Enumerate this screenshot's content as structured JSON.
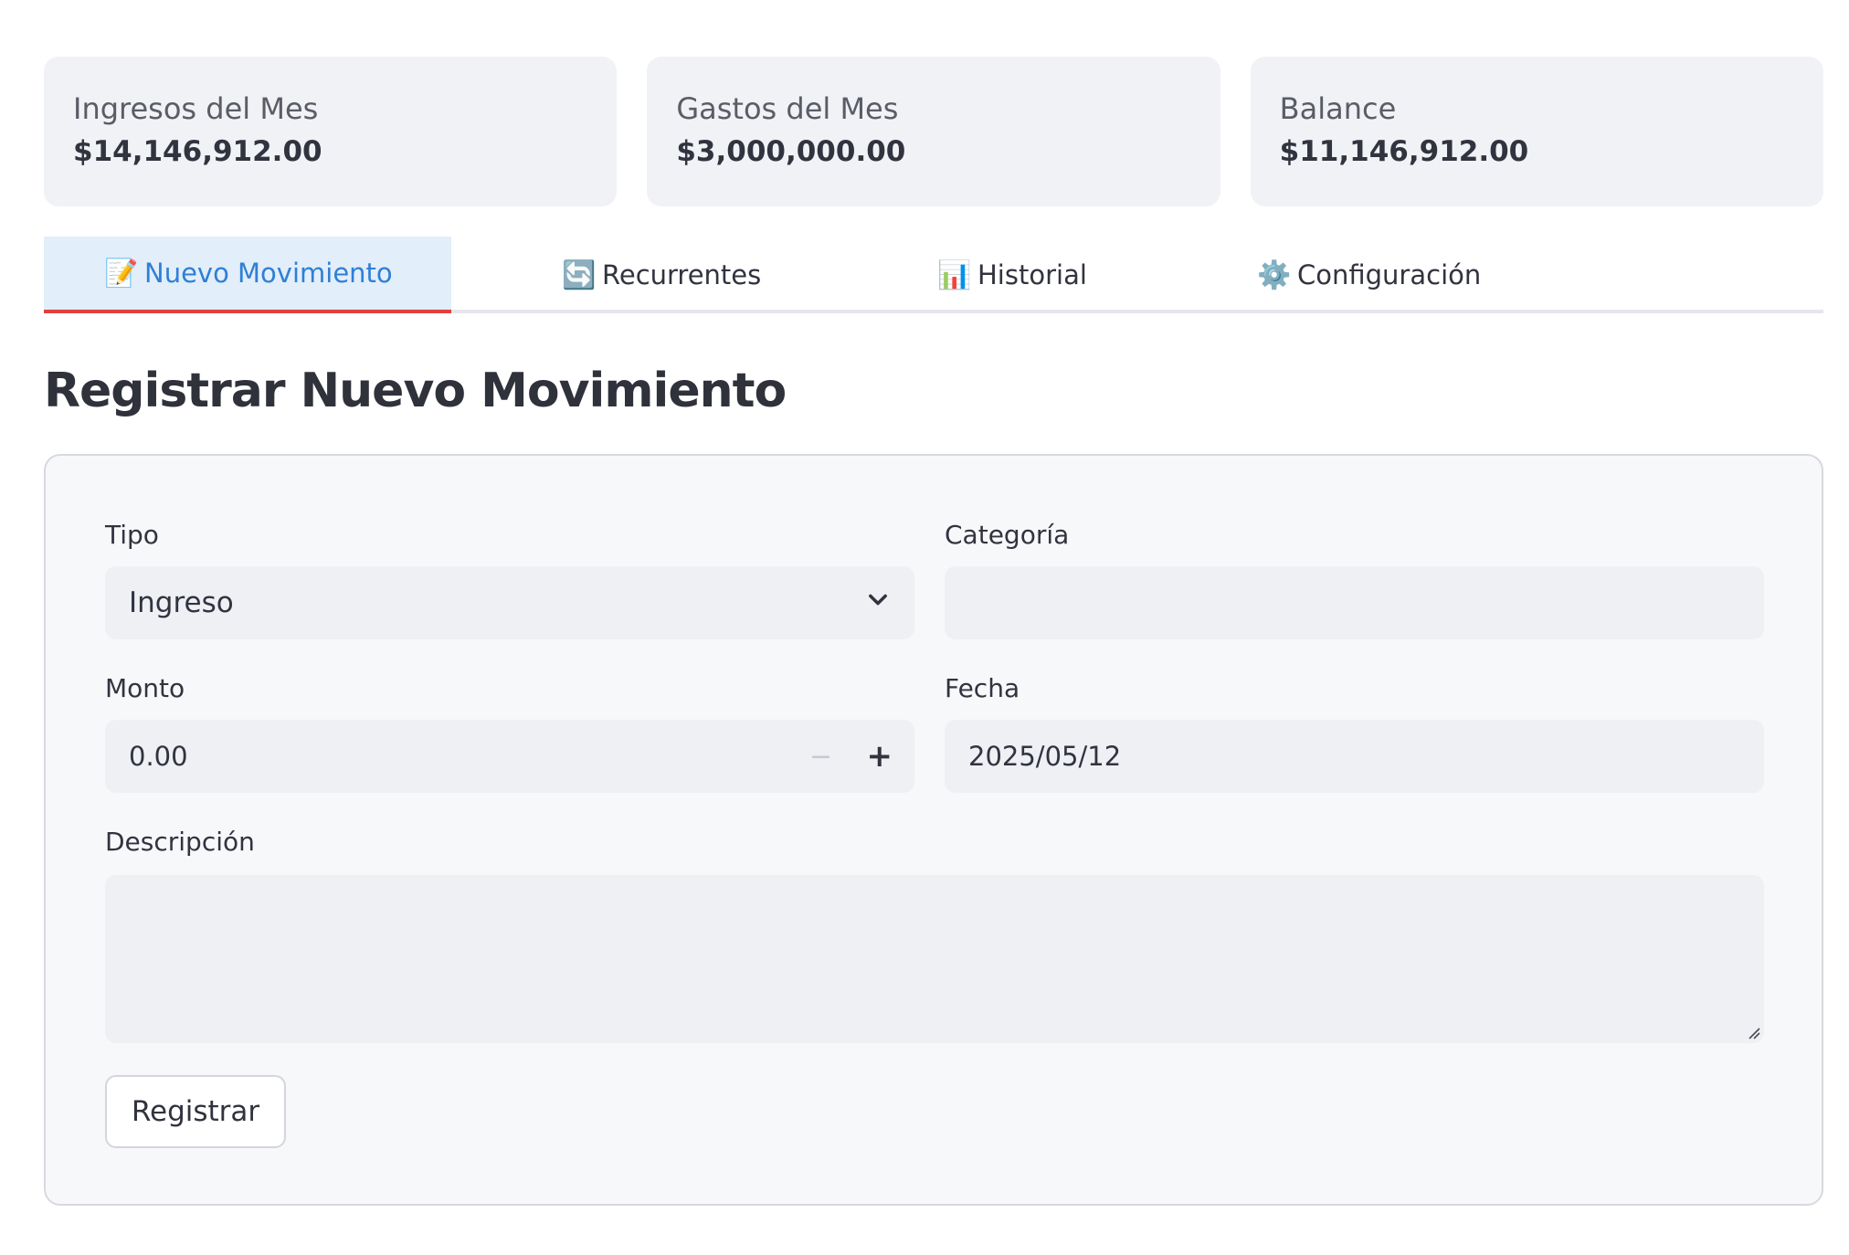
{
  "metrics": [
    {
      "label": "Ingresos del Mes",
      "value": "$14,146,912.00"
    },
    {
      "label": "Gastos del Mes",
      "value": "$3,000,000.00"
    },
    {
      "label": "Balance",
      "value": "$11,146,912.00"
    }
  ],
  "tabs": [
    {
      "label": "Nuevo Movimiento",
      "icon": "📝",
      "active": true
    },
    {
      "label": "Recurrentes",
      "icon": "🔄",
      "active": false
    },
    {
      "label": "Historial",
      "icon": "📊",
      "active": false
    },
    {
      "label": "Configuración",
      "icon": "⚙️",
      "active": false
    }
  ],
  "page_title": "Registrar Nuevo Movimiento",
  "form": {
    "tipo": {
      "label": "Tipo",
      "value": "Ingreso"
    },
    "categoria": {
      "label": "Categoría",
      "value": ""
    },
    "monto": {
      "label": "Monto",
      "value": "0.00",
      "minus": "−",
      "plus": "+"
    },
    "fecha": {
      "label": "Fecha",
      "value": "2025/05/12"
    },
    "descripcion": {
      "label": "Descripción",
      "value": ""
    },
    "submit_label": "Registrar"
  },
  "colors": {
    "accent": "#2f7fd6",
    "tab_indicator": "#e0413d",
    "card_bg": "#f0f2f6"
  }
}
